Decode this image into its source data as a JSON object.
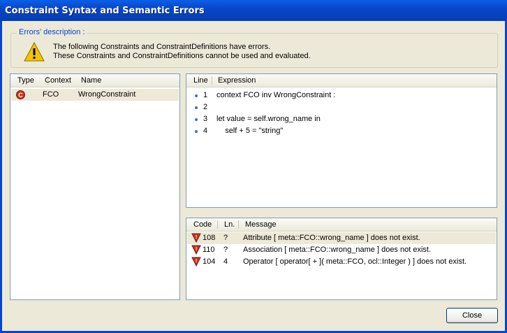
{
  "window": {
    "title": "Constraint Syntax and Semantic Errors"
  },
  "errors_group": {
    "legend": "Errors' description :",
    "line1": "The following Constraints and ConstraintDefinitions have errors.",
    "line2": "These Constraints and ConstraintDefinitions cannot be used and evaluated."
  },
  "constraints_table": {
    "headers": {
      "type": "Type",
      "context": "Context",
      "name": "Name"
    },
    "rows": [
      {
        "type_icon": "constraint-error-icon",
        "context": "FCO",
        "name": "WrongConstraint"
      }
    ]
  },
  "expression_table": {
    "headers": {
      "line": "Line",
      "expression": "Expression"
    },
    "rows": [
      {
        "line": "1",
        "expression": "context FCO inv WrongConstraint :"
      },
      {
        "line": "2",
        "expression": ""
      },
      {
        "line": "3",
        "expression": "let value = self.wrong_name in"
      },
      {
        "line": "4",
        "expression": "    self + 5 = \"string\""
      }
    ]
  },
  "messages_table": {
    "headers": {
      "code": "Code",
      "ln": "Ln.",
      "message": "Message"
    },
    "rows": [
      {
        "icon": "error-shield-icon",
        "code": "108",
        "ln": "?",
        "message": "Attribute [ meta::FCO::wrong_name ] does not exist."
      },
      {
        "icon": "error-shield-icon",
        "code": "110",
        "ln": "?",
        "message": "Association [ meta::FCO::wrong_name ] does not exist."
      },
      {
        "icon": "error-shield-icon",
        "code": "104",
        "ln": "4",
        "message": "Operator [ operator[ + ]( meta::FCO, ocl::Integer ) ] does not exist."
      }
    ]
  },
  "buttons": {
    "close": "Close"
  },
  "colors": {
    "titlebar": "#0a5fe8",
    "legend_text": "#0046d5",
    "error_red": "#c8321c"
  }
}
